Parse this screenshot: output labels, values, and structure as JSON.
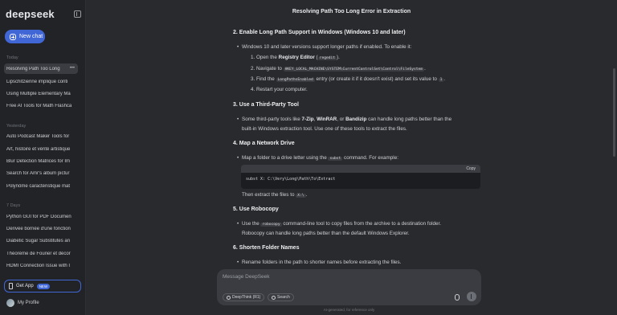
{
  "sidebar": {
    "logo": "deepseek",
    "new_chat_label": "New chat",
    "sections": [
      {
        "label": "Today",
        "items": [
          "Resolving Path Too Long",
          "Lipschitzienne implique conti",
          "Using Multiple Elementary Ma",
          "Free AI Tools for Math Flashca"
        ]
      },
      {
        "label": "Yesterday",
        "items": [
          "Auto Podcast Maker Tools for",
          "Art, histoire et vérité artistique",
          "Blur Detection Matrices for Im",
          "Search for Amr's album pictur",
          "Polynôme caractéristique mat"
        ]
      },
      {
        "label": "7 Days",
        "items": [
          "Python GUI for PDF Documen",
          "Dérivée bornée d'une fonction",
          "Diabetic Sugar Substitutes an",
          "Théorème de Fourier et décor",
          "HDMI Connection Issue with I"
        ]
      }
    ],
    "get_app": "Get App",
    "new_badge": "NEW",
    "profile": "My Profile"
  },
  "header": {
    "title": "Resolving Path Too Long Error in Extraction"
  },
  "article": {
    "s2": {
      "heading": "2. Enable Long Path Support in Windows (Windows 10 and later)",
      "intro": "Windows 10 and later versions support longer paths if enabled. To enable it:",
      "step1_a": "1. Open the ",
      "step1_b": "Registry Editor",
      "step1_code": "regedit",
      "step2_a": "2. Navigate to ",
      "step2_code": "HKEY_LOCAL_MACHINE\\SYSTEM\\CurrentControlSet\\Control\\FileSystem",
      "step3_a": "3. Find the ",
      "step3_code": "LongPathsEnabled",
      "step3_b": " entry (or create it if it doesn't exist) and set its value to ",
      "step3_code2": "1",
      "step4": "4. Restart your computer."
    },
    "s3": {
      "heading": "3. Use a Third-Party Tool",
      "line1_a": "Some third-party tools like ",
      "tool1": "7-Zip",
      "tool2": "WinRAR",
      "tool3": "Bandizip",
      "line1_b": " can handle long paths better than the",
      "line2": "built-in Windows extraction tool. Use one of these tools to extract the files."
    },
    "s4": {
      "heading": "4. Map a Network Drive",
      "line1_a": "Map a folder to a drive letter using the ",
      "line1_code": "subst",
      "line1_b": " command. For example:",
      "copy": "Copy",
      "code": "subst X: C:\\Very\\Long\\Path\\To\\Extract",
      "after_a": "Then extract the files to ",
      "after_code": "X:\\"
    },
    "s5": {
      "heading": "5. Use Robocopy",
      "line1_a": "Use the ",
      "line1_code": "robocopy",
      "line1_b": " command-line tool to copy files from the archive to a destination folder.",
      "line2": "Robocopy can handle long paths better than the default Windows Explorer."
    },
    "s6": {
      "heading": "6. Shorten Folder Names",
      "line1": "Rename folders in the path to shorter names before extracting the files."
    }
  },
  "composer": {
    "placeholder": "Message DeepSeek",
    "deepthink": "DeepThink (R1)",
    "search": "Search",
    "disclaimer": "AI-generated, for reference only"
  }
}
